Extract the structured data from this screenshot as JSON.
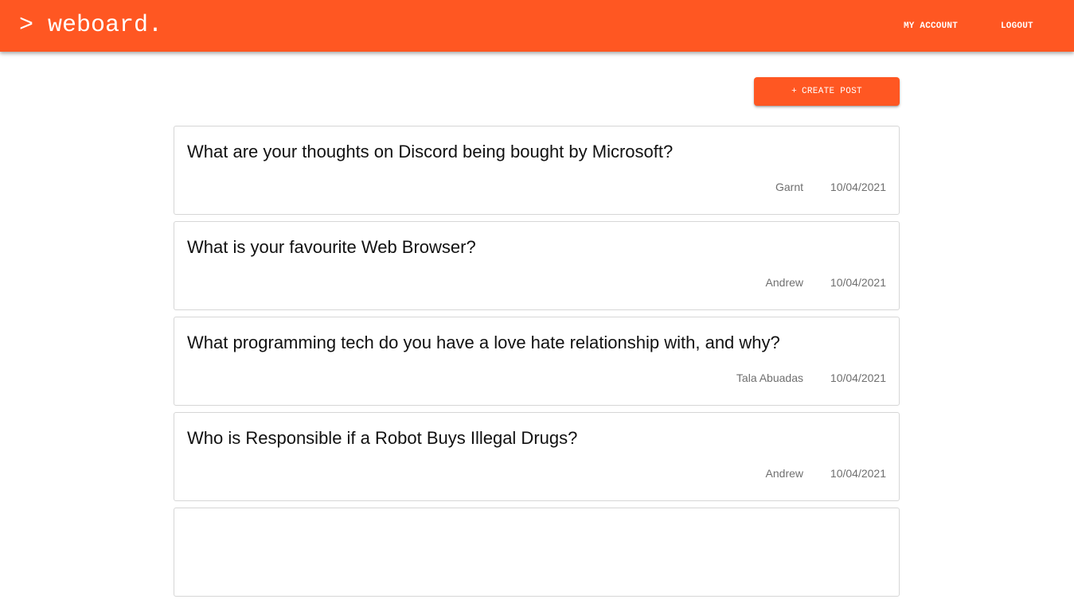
{
  "header": {
    "logo_text": "> weboard.",
    "nav": {
      "my_account_label": "MY ACCOUNT",
      "logout_label": "LOGOUT"
    }
  },
  "toolbar": {
    "create_post_icon": "+",
    "create_post_label": "CREATE POST"
  },
  "posts": [
    {
      "title": "What are your thoughts on Discord being bought by Microsoft?",
      "author": "Garnt",
      "date": "10/04/2021"
    },
    {
      "title": "What is your favourite Web Browser?",
      "author": "Andrew",
      "date": "10/04/2021"
    },
    {
      "title": "What programming tech do you have a love hate relationship with, and why?",
      "author": "Tala Abuadas",
      "date": "10/04/2021"
    },
    {
      "title": "Who is Responsible if a Robot Buys Illegal Drugs?",
      "author": "Andrew",
      "date": "10/04/2021"
    },
    {
      "title": "",
      "author": "",
      "date": ""
    }
  ],
  "colors": {
    "accent": "#ff5722",
    "text_primary": "#111111",
    "text_secondary": "#6f6f6f",
    "card_border": "#d6d6d6"
  }
}
